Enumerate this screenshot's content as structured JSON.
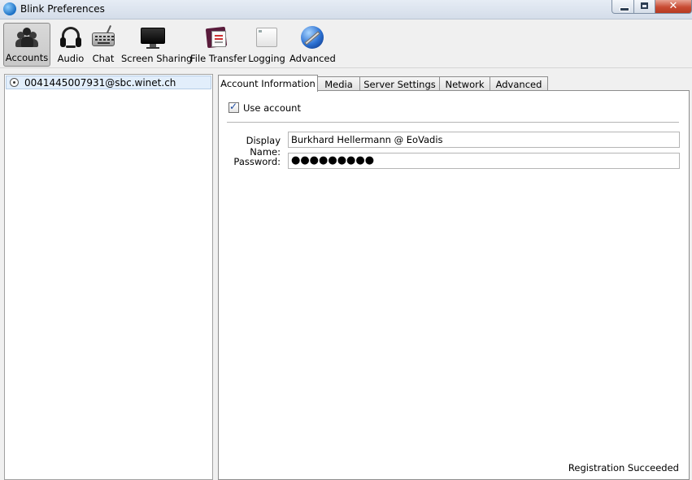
{
  "window": {
    "title": "Blink Preferences"
  },
  "toolbar": {
    "items": [
      {
        "label": "Accounts",
        "icon": "users-icon",
        "active": true
      },
      {
        "label": "Audio",
        "icon": "headset-icon"
      },
      {
        "label": "Chat",
        "icon": "keyboard-icon"
      },
      {
        "label": "Screen Sharing",
        "icon": "monitor-icon"
      },
      {
        "label": "File Transfer",
        "icon": "file-transfer-icon"
      },
      {
        "label": "Logging",
        "icon": "log-window-icon"
      },
      {
        "label": "Advanced",
        "icon": "globe-wrench-icon"
      }
    ]
  },
  "accounts": [
    {
      "address": "0041445007931@sbc.winet.ch",
      "selected": true
    }
  ],
  "tabs": [
    {
      "label": "Account Information",
      "active": true
    },
    {
      "label": "Media"
    },
    {
      "label": "Server Settings"
    },
    {
      "label": "Network"
    },
    {
      "label": "Advanced"
    }
  ],
  "account_info": {
    "use_account_label": "Use account",
    "use_account_checked": true,
    "display_name_label": "Display Name:",
    "display_name_value": "Burkhard Hellermann @ EoVadis",
    "password_label": "Password:",
    "password_masked": "●●●●●●●●●"
  },
  "status": {
    "text": "Registration Succeeded"
  }
}
